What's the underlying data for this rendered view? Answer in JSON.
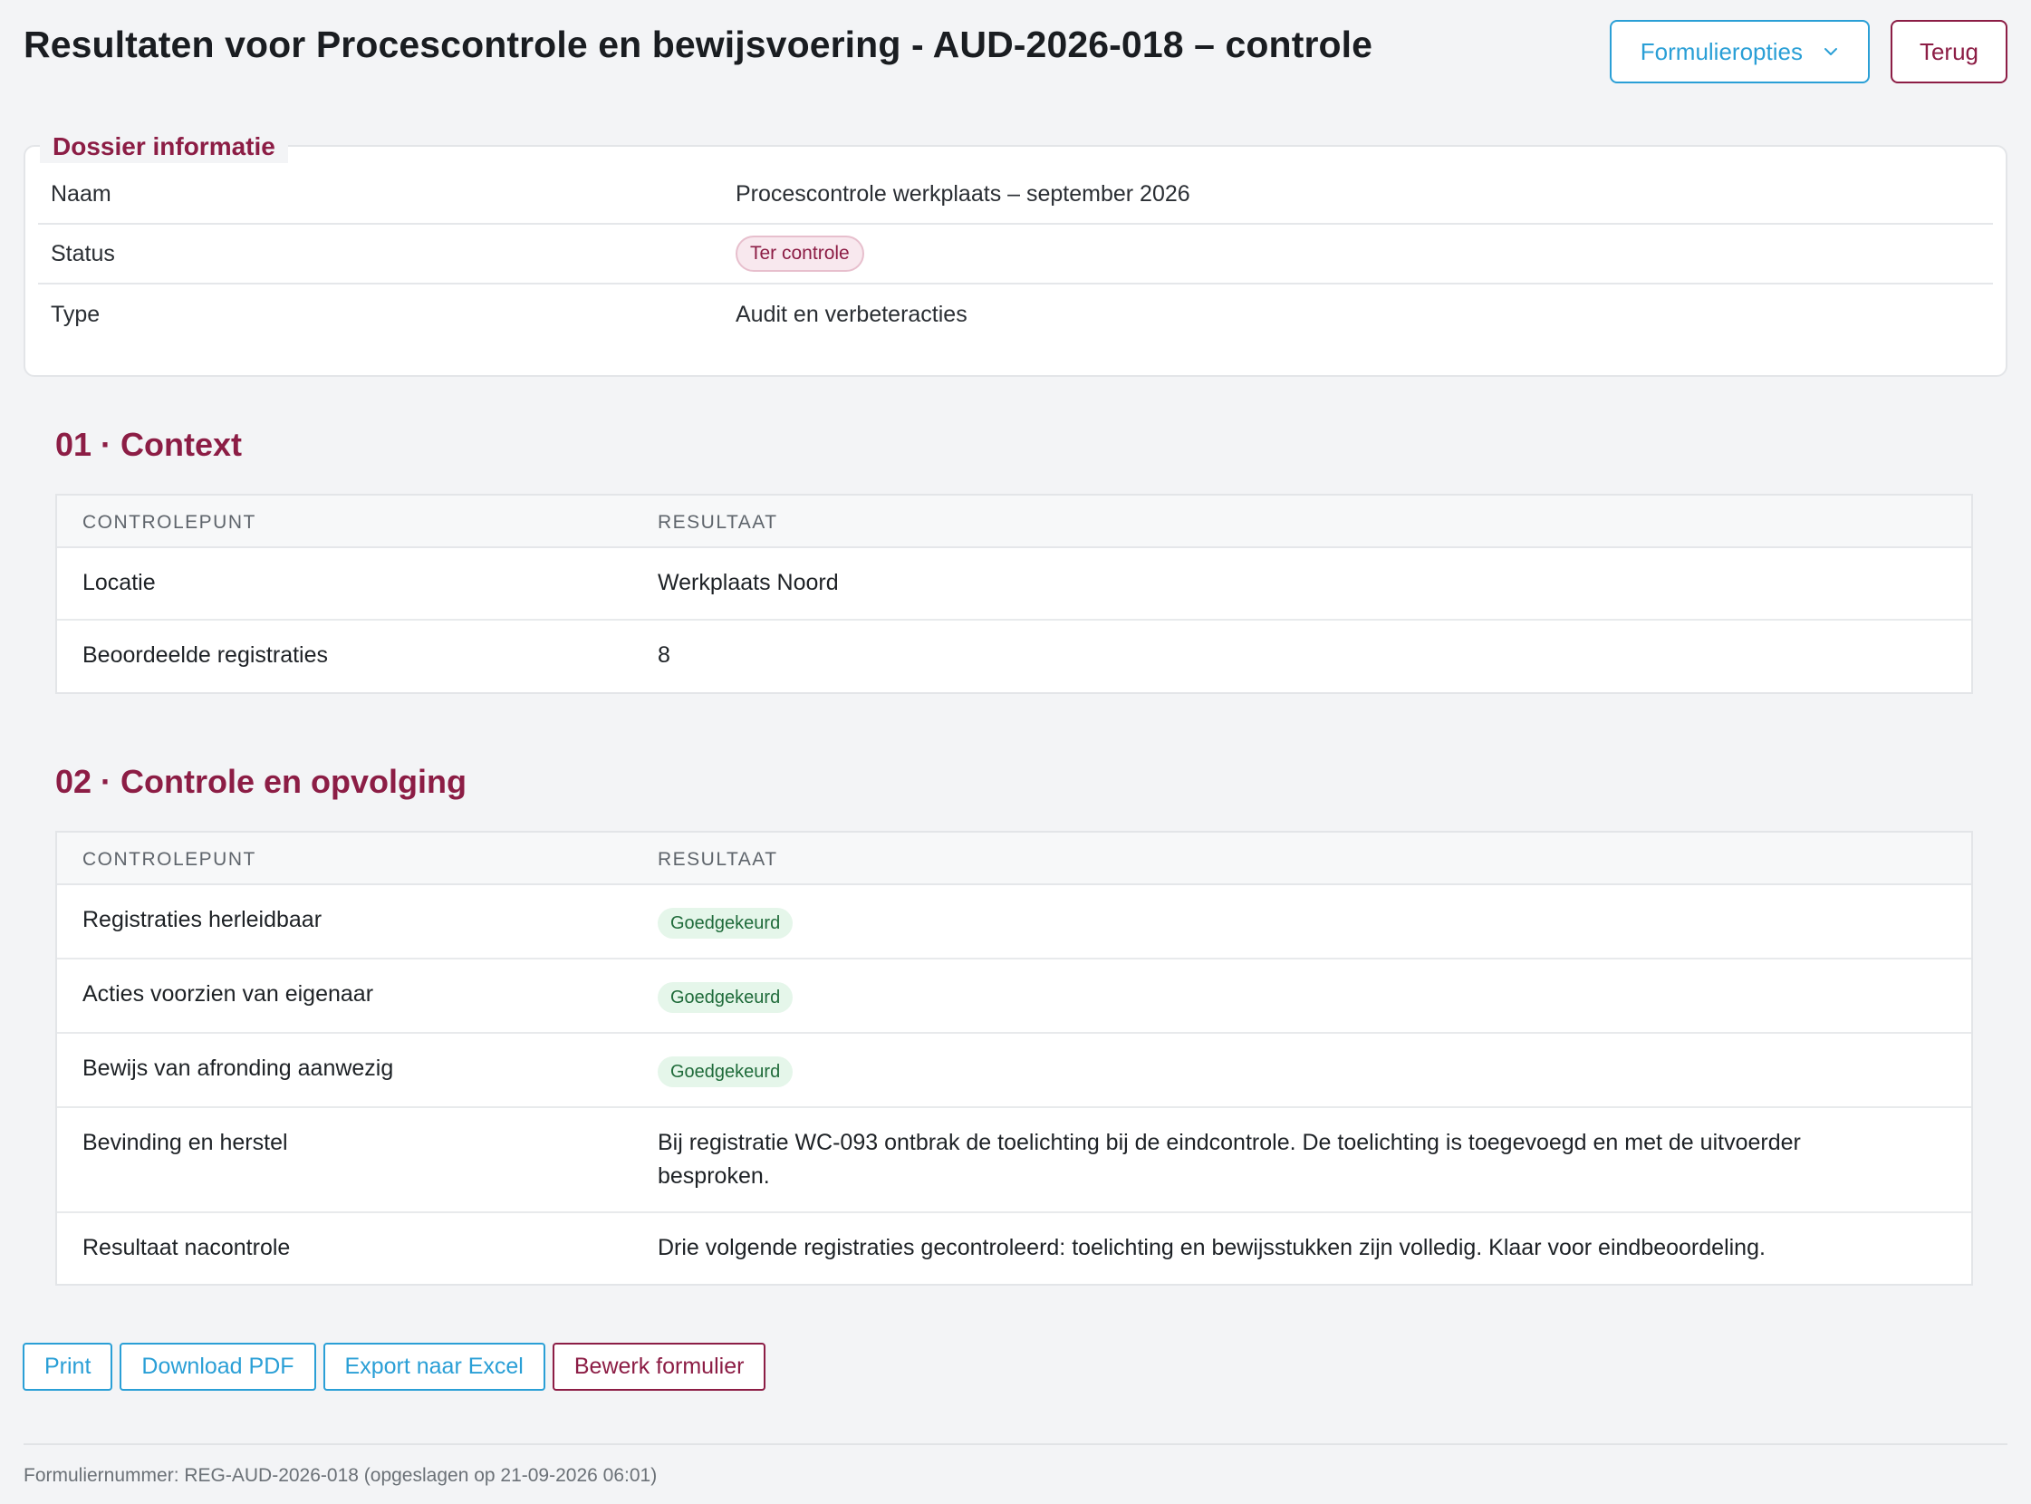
{
  "header": {
    "title": "Resultaten voor Procescontrole en bewijsvoering - AUD-2026-018 – controle",
    "form_options_label": "Formulieropties",
    "back_label": "Terug"
  },
  "dossier": {
    "legend": "Dossier informatie",
    "rows": [
      {
        "key": "Naam",
        "value": "Procescontrole werkplaats – september 2026"
      },
      {
        "key": "Status",
        "value": "Ter controle"
      },
      {
        "key": "Type",
        "value": "Audit en verbeteracties"
      }
    ]
  },
  "sections": [
    {
      "title": "01 · Context",
      "col1": "CONTROLEPUNT",
      "col2": "RESULTAAT",
      "rows": [
        {
          "point": "Locatie",
          "result": "Werkplaats Noord"
        },
        {
          "point": "Beoordeelde registraties",
          "result": "8"
        }
      ]
    },
    {
      "title": "02 · Controle en opvolging",
      "col1": "CONTROLEPUNT",
      "col2": "RESULTAAT",
      "rows": [
        {
          "point": "Registraties herleidbaar",
          "result": "Goedgekeurd"
        },
        {
          "point": "Acties voorzien van eigenaar",
          "result": "Goedgekeurd"
        },
        {
          "point": "Bewijs van afronding aanwezig",
          "result": "Goedgekeurd"
        },
        {
          "point": "Bevinding en herstel",
          "result": "Bij registratie WC-093 ontbrak de toelichting bij de eindcontrole. De toelichting is toegevoegd en met de uitvoerder besproken."
        },
        {
          "point": "Resultaat nacontrole",
          "result": "Drie volgende registraties gecontroleerd: toelichting en bewijsstukken zijn volledig. Klaar voor eindbeoordeling."
        }
      ]
    }
  ],
  "actions": {
    "print": "Print",
    "pdf": "Download PDF",
    "excel": "Export naar Excel",
    "edit": "Bewerk formulier"
  },
  "footer": {
    "text": "Formuliernummer: REG-AUD-2026-018 (opgeslagen op 21-09-2026 06:01)"
  },
  "colors": {
    "accent_red": "#8c1d45",
    "accent_blue": "#2a9fd6",
    "approved_bg": "#e5f6ea",
    "approved_text": "#1f6b3a"
  },
  "icons": {
    "form_options": "chevron-down-icon"
  }
}
